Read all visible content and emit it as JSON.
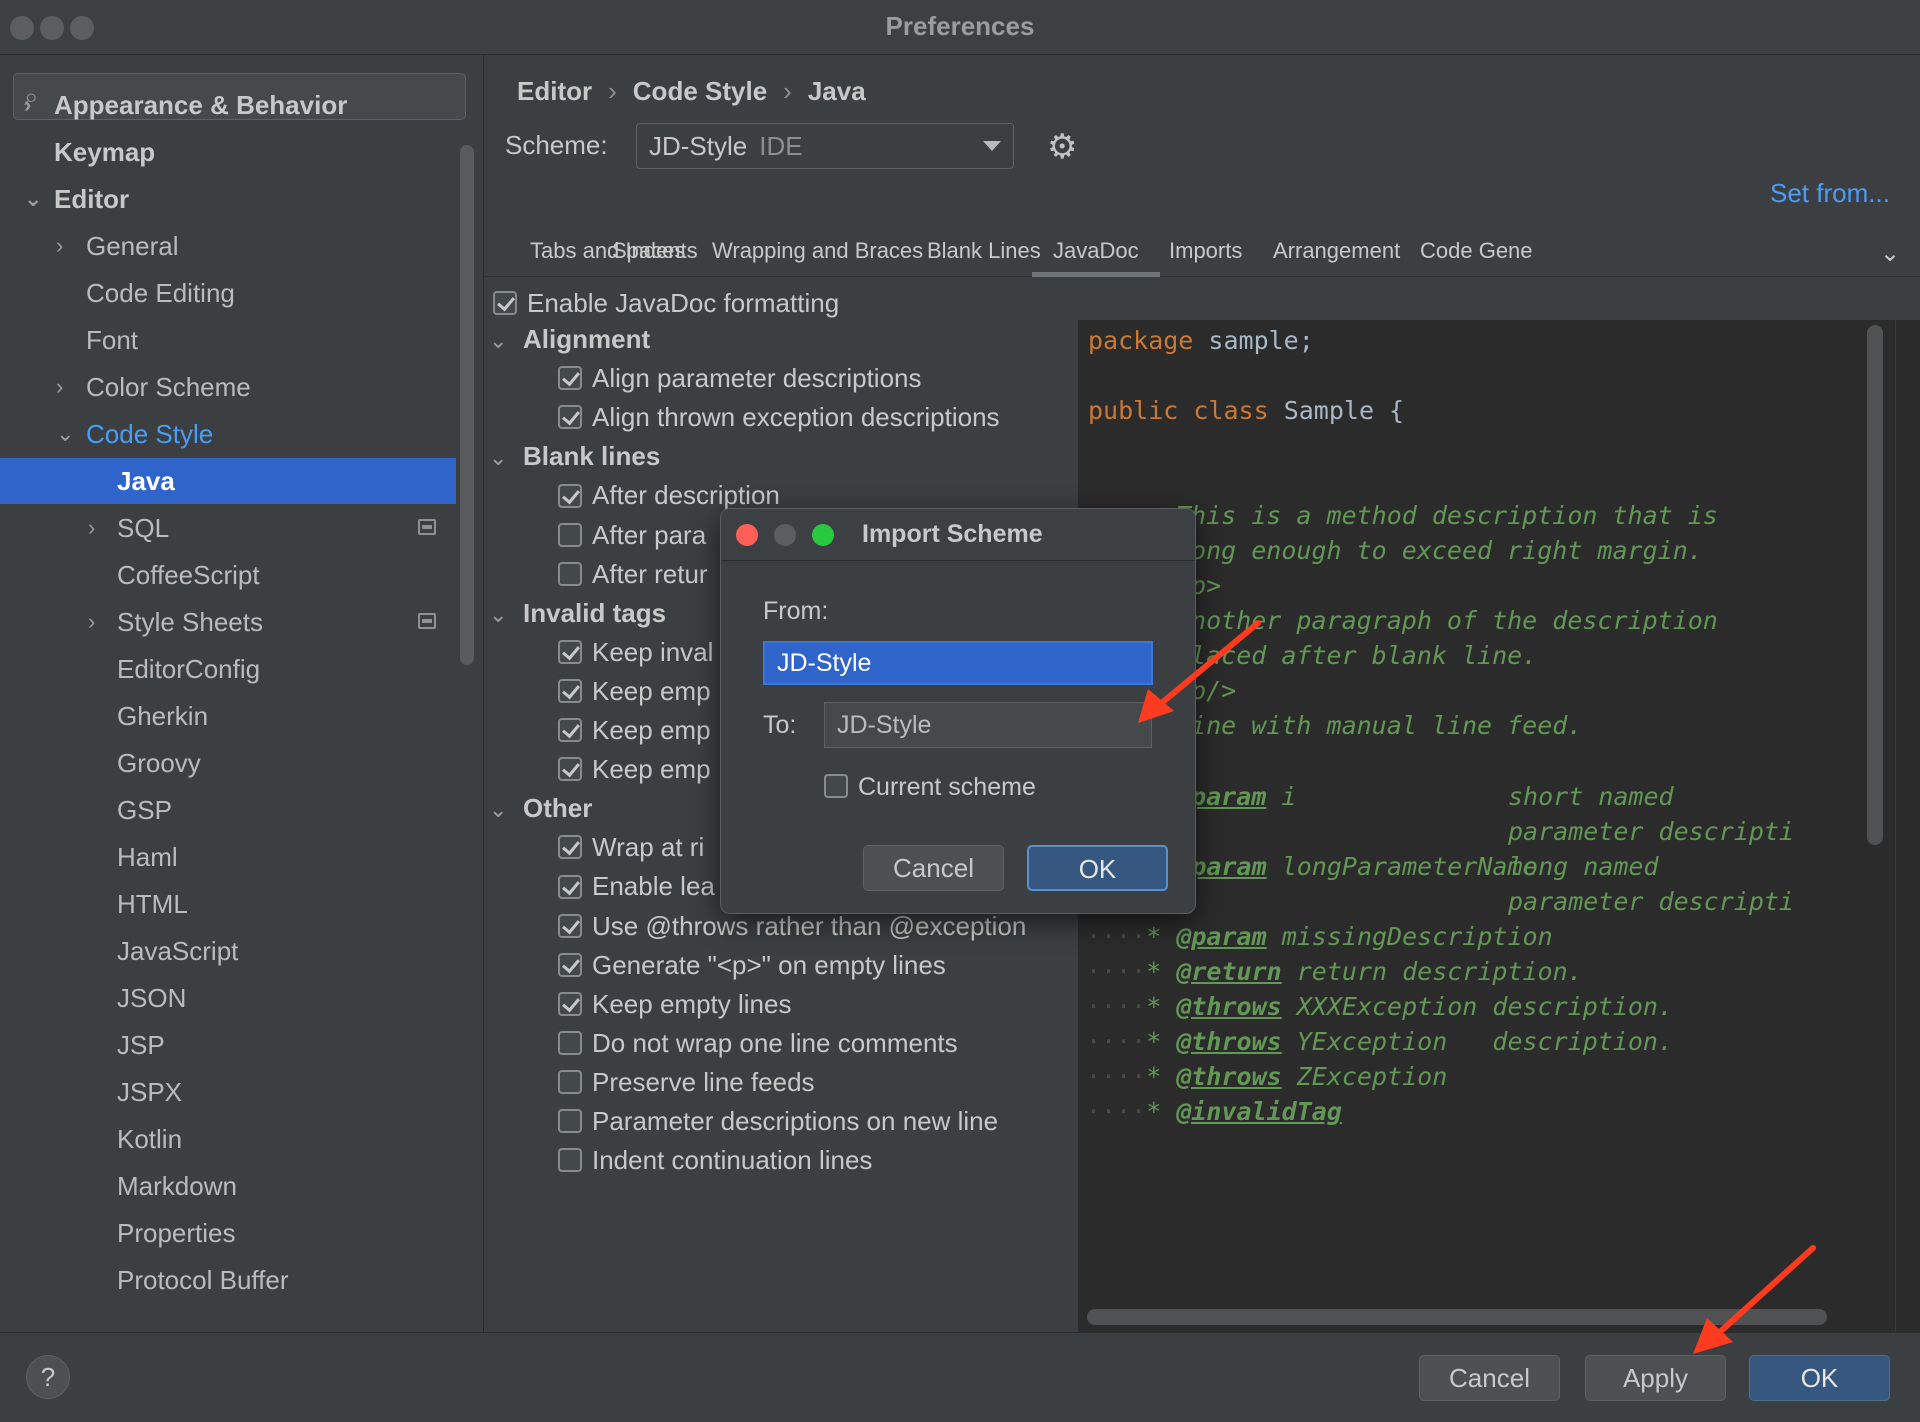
{
  "window": {
    "title": "Preferences"
  },
  "sidebar": {
    "search_placeholder": "",
    "items": [
      {
        "label": "Appearance & Behavior",
        "arrow": "›"
      },
      {
        "label": "Keymap"
      },
      {
        "label": "Editor",
        "arrow": "⌄"
      },
      {
        "label": "General",
        "arrow": "›"
      },
      {
        "label": "Code Editing"
      },
      {
        "label": "Font"
      },
      {
        "label": "Color Scheme",
        "arrow": "›"
      },
      {
        "label": "Code Style",
        "arrow": "⌄"
      },
      {
        "label": "Java"
      },
      {
        "label": "SQL",
        "arrow": "›"
      },
      {
        "label": "CoffeeScript"
      },
      {
        "label": "Style Sheets",
        "arrow": "›"
      },
      {
        "label": "EditorConfig"
      },
      {
        "label": "Gherkin"
      },
      {
        "label": "Groovy"
      },
      {
        "label": "GSP"
      },
      {
        "label": "Haml"
      },
      {
        "label": "HTML"
      },
      {
        "label": "JavaScript"
      },
      {
        "label": "JSON"
      },
      {
        "label": "JSP"
      },
      {
        "label": "JSPX"
      },
      {
        "label": "Kotlin"
      },
      {
        "label": "Markdown"
      },
      {
        "label": "Properties"
      },
      {
        "label": "Protocol Buffer"
      }
    ]
  },
  "breadcrumb": {
    "a": "Editor",
    "b": "Code Style",
    "c": "Java",
    "sep": "›"
  },
  "scheme": {
    "label": "Scheme:",
    "value": "JD-Style",
    "sub": "IDE"
  },
  "set_from": "Set from...",
  "tabs": [
    "Tabs and Indents",
    "Spaces",
    "Wrapping and Braces",
    "Blank Lines",
    "JavaDoc",
    "Imports",
    "Arrangement",
    "Code Gene"
  ],
  "active_tab": "JavaDoc",
  "enable_javadoc": {
    "label": "Enable JavaDoc formatting",
    "checked": true
  },
  "options": [
    {
      "type": "group",
      "label": "Alignment"
    },
    {
      "label": "Align parameter descriptions",
      "checked": true
    },
    {
      "label": "Align thrown exception descriptions",
      "checked": true
    },
    {
      "type": "group",
      "label": "Blank lines"
    },
    {
      "label": "After description",
      "checked": true
    },
    {
      "label": "After para",
      "checked": false
    },
    {
      "label": "After retur",
      "checked": false
    },
    {
      "type": "group",
      "label": "Invalid tags"
    },
    {
      "label": "Keep inval",
      "checked": true
    },
    {
      "label": "Keep emp",
      "checked": true
    },
    {
      "label": "Keep emp",
      "checked": true
    },
    {
      "label": "Keep emp",
      "checked": true
    },
    {
      "type": "group",
      "label": "Other"
    },
    {
      "label": "Wrap at ri",
      "checked": true
    },
    {
      "label": "Enable lea",
      "checked": true
    },
    {
      "label": "Use @throws rather than @exception",
      "checked": true
    },
    {
      "label": "Generate \"<p>\" on empty lines",
      "checked": true
    },
    {
      "label": "Keep empty lines",
      "checked": true
    },
    {
      "label": "Do not wrap one line comments",
      "checked": false
    },
    {
      "label": "Preserve line feeds",
      "checked": false
    },
    {
      "label": "Parameter descriptions on new line",
      "checked": false
    },
    {
      "label": "Indent continuation lines",
      "checked": false
    }
  ],
  "code": {
    "l1_kw": "package",
    "l1_rest": " sample;",
    "l2_kw1": "public",
    "l2_kw2": "class",
    "l2_rest": " Sample {",
    "c1": "This is a method description that is",
    "c2": "Long enough to exceed right margin.",
    "c3": "<p>",
    "c4": "Another paragraph of the description",
    "c5": "placed after blank line.",
    "c6": "<p/>",
    "c7": "Line with manual line feed.",
    "p1_tag": "@param",
    "p1_name": " i",
    "p1_desc": "short named",
    "p1b_desc": "parameter descripti",
    "p2_tag": "@param",
    "p2_name": " longParameterName",
    "p2_desc": "long named",
    "p2b_desc": "parameter descripti",
    "p3_tag": "@param",
    "p3_name": " missingDescription",
    "r_tag": "@return",
    "r_desc": " return description.",
    "t1_tag": "@throws",
    "t1_desc": " XXXException description.",
    "t2_tag": "@throws",
    "t2_desc": " YException   description.",
    "t3_tag": "@throws",
    "t3_desc": " ZException",
    "i_tag": "@invalidTag"
  },
  "dialog": {
    "title": "Import Scheme",
    "from_label": "From:",
    "from_value": "JD-Style",
    "to_label": "To:",
    "to_value": "JD-Style",
    "current_scheme_label": "Current scheme",
    "current_scheme_checked": false,
    "cancel": "Cancel",
    "ok": "OK"
  },
  "footer": {
    "help": "?",
    "cancel": "Cancel",
    "apply": "Apply",
    "ok": "OK"
  },
  "colors": {
    "accent": "#2f65ca",
    "link": "#4a9cf6",
    "keyword": "#cc7832",
    "doc_comment": "#629755",
    "annotation_arrow": "#ff3b1f"
  }
}
